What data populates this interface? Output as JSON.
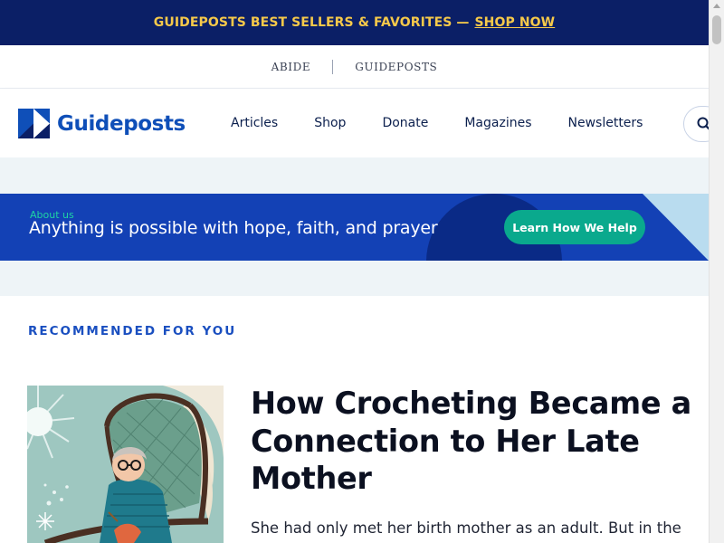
{
  "promo": {
    "text": "GUIDEPOSTS BEST SELLERS & FAVORITES —",
    "link": "SHOP NOW"
  },
  "subbar": {
    "brands": [
      "ABIDE",
      "GUIDEPOSTS"
    ]
  },
  "nav": {
    "logo_text": "Guideposts",
    "links": [
      "Articles",
      "Shop",
      "Donate",
      "Magazines",
      "Newsletters"
    ],
    "search_icon": "search-icon"
  },
  "banner": {
    "kicker": "About us",
    "headline": "Anything is possible with hope, faith, and prayer",
    "cta": "Learn How We Help"
  },
  "recommended": {
    "label": "RECOMMENDED FOR YOU",
    "article": {
      "title": "How Crocheting Became a Connection to Her Late Mother",
      "excerpt": "She had only met her birth mother as an adult. But in the"
    }
  },
  "colors": {
    "promo_bg": "#0b1f66",
    "promo_text": "#f6c94a",
    "brand_blue": "#0f4fb8",
    "banner_bg": "#1341b5",
    "cta_bg": "#0aa98d",
    "accent_label": "#1a4fc0"
  }
}
